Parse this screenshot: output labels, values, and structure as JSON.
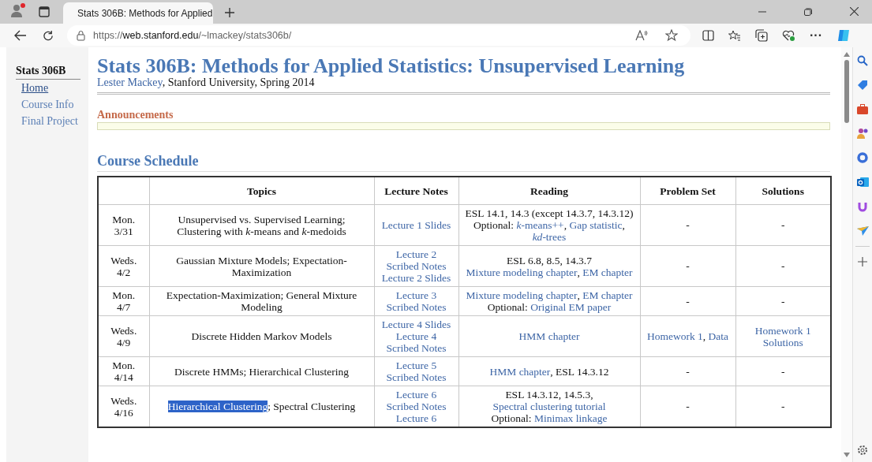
{
  "browser": {
    "tab_title": "Stats 306B: Methods for Applied",
    "url_scheme": "https://",
    "url_host": "web.stanford.edu",
    "url_path": "/~lmackey/stats306b/",
    "more": "···"
  },
  "sidebar": {
    "title": "Stats 306B",
    "items": [
      {
        "label": "Home",
        "selected": true
      },
      {
        "label": "Course Info",
        "selected": false
      },
      {
        "label": "Final Project",
        "selected": false
      }
    ]
  },
  "page": {
    "title": "Stats 306B: Methods for Applied Statistics: Unsupervised Learning",
    "byline": [
      {
        "kind": "link",
        "text": "Lester Mackey"
      },
      {
        "kind": "text",
        "text": ", Stanford University, Spring 2014"
      }
    ],
    "announcements_heading": "Announcements",
    "schedule_heading": "Course Schedule",
    "table": {
      "columns": [
        "Topics",
        "Lecture Notes",
        "Reading",
        "Problem Set",
        "Solutions"
      ],
      "rows": [
        {
          "date": "Mon. 3/31",
          "topics": [
            {
              "kind": "text",
              "text": "Unsupervised vs. Supervised Learning; Clustering with *k*-means and *k*-medoids"
            }
          ],
          "notes": [
            {
              "kind": "link",
              "text": "Lecture 1 Slides"
            }
          ],
          "reading": [
            {
              "kind": "text",
              "text": "ESL 14.1, 14.3 (except 14.3.7, 14.3.12)"
            },
            {
              "kind": "break"
            },
            {
              "kind": "text",
              "text": "Optional: "
            },
            {
              "kind": "link",
              "text": "*k*-means++"
            },
            {
              "kind": "text",
              "text": ", "
            },
            {
              "kind": "link",
              "text": "Gap statistic"
            },
            {
              "kind": "text",
              "text": ", "
            },
            {
              "kind": "link",
              "text": "*kd*-trees"
            }
          ],
          "problem_set": [
            {
              "kind": "text",
              "text": "-"
            }
          ],
          "solutions": [
            {
              "kind": "text",
              "text": "-"
            }
          ]
        },
        {
          "date": "Weds. 4/2",
          "topics": [
            {
              "kind": "text",
              "text": "Gaussian Mixture Models; Expectation-Maximization"
            }
          ],
          "notes": [
            {
              "kind": "link",
              "text": "Lecture 2 Scribed Notes"
            },
            {
              "kind": "break"
            },
            {
              "kind": "link",
              "text": "Lecture 2 Slides"
            }
          ],
          "reading": [
            {
              "kind": "text",
              "text": "ESL 6.8, 8.5, 14.3.7"
            },
            {
              "kind": "break"
            },
            {
              "kind": "link",
              "text": "Mixture modeling chapter"
            },
            {
              "kind": "text",
              "text": ", "
            },
            {
              "kind": "link",
              "text": "EM chapter"
            }
          ],
          "problem_set": [
            {
              "kind": "text",
              "text": "-"
            }
          ],
          "solutions": [
            {
              "kind": "text",
              "text": "-"
            }
          ]
        },
        {
          "date": "Mon. 4/7",
          "topics": [
            {
              "kind": "text",
              "text": "Expectation-Maximization; General Mixture Modeling"
            }
          ],
          "notes": [
            {
              "kind": "link",
              "text": "Lecture 3 Scribed Notes"
            }
          ],
          "reading": [
            {
              "kind": "link",
              "text": "Mixture modeling chapter"
            },
            {
              "kind": "text",
              "text": ", "
            },
            {
              "kind": "link",
              "text": "EM chapter"
            },
            {
              "kind": "break"
            },
            {
              "kind": "text",
              "text": "Optional: "
            },
            {
              "kind": "link",
              "text": "Original EM paper"
            }
          ],
          "problem_set": [
            {
              "kind": "text",
              "text": "-"
            }
          ],
          "solutions": [
            {
              "kind": "text",
              "text": "-"
            }
          ]
        },
        {
          "date": "Weds. 4/9",
          "topics": [
            {
              "kind": "text",
              "text": "Discrete Hidden Markov Models"
            }
          ],
          "notes": [
            {
              "kind": "link",
              "text": "Lecture 4 Slides"
            },
            {
              "kind": "break"
            },
            {
              "kind": "link",
              "text": "Lecture 4 Scribed Notes"
            }
          ],
          "reading": [
            {
              "kind": "link",
              "text": "HMM chapter"
            }
          ],
          "problem_set": [
            {
              "kind": "link",
              "text": "Homework 1"
            },
            {
              "kind": "text",
              "text": ", "
            },
            {
              "kind": "link",
              "text": "Data"
            }
          ],
          "solutions": [
            {
              "kind": "link",
              "text": "Homework 1 Solutions"
            }
          ]
        },
        {
          "date": "Mon. 4/14",
          "topics": [
            {
              "kind": "text",
              "text": "Discrete HMMs; Hierarchical Clustering"
            }
          ],
          "notes": [
            {
              "kind": "link",
              "text": "Lecture 5 Scribed Notes"
            }
          ],
          "reading": [
            {
              "kind": "link",
              "text": "HMM chapter"
            },
            {
              "kind": "text",
              "text": ", ESL 14.3.12"
            }
          ],
          "problem_set": [
            {
              "kind": "text",
              "text": "-"
            }
          ],
          "solutions": [
            {
              "kind": "text",
              "text": "-"
            }
          ]
        },
        {
          "date": "Weds. 4/16",
          "topics": [
            {
              "kind": "highlight",
              "text": "Hierarchical Clustering"
            },
            {
              "kind": "text",
              "text": "; Spectral Clustering"
            }
          ],
          "notes": [
            {
              "kind": "link",
              "text": "Lecture 6 Scribed Notes"
            },
            {
              "kind": "break"
            },
            {
              "kind": "link",
              "text": "Lecture 6"
            }
          ],
          "reading": [
            {
              "kind": "text",
              "text": "ESL 14.3.12, 14.5.3, "
            },
            {
              "kind": "link",
              "text": "Spectral clustering tutorial"
            },
            {
              "kind": "break"
            },
            {
              "kind": "text",
              "text": "Optional: "
            },
            {
              "kind": "link",
              "text": "Minimax linkage"
            }
          ],
          "problem_set": [
            {
              "kind": "text",
              "text": "-"
            }
          ],
          "solutions": [
            {
              "kind": "text",
              "text": "-"
            }
          ]
        }
      ]
    }
  }
}
